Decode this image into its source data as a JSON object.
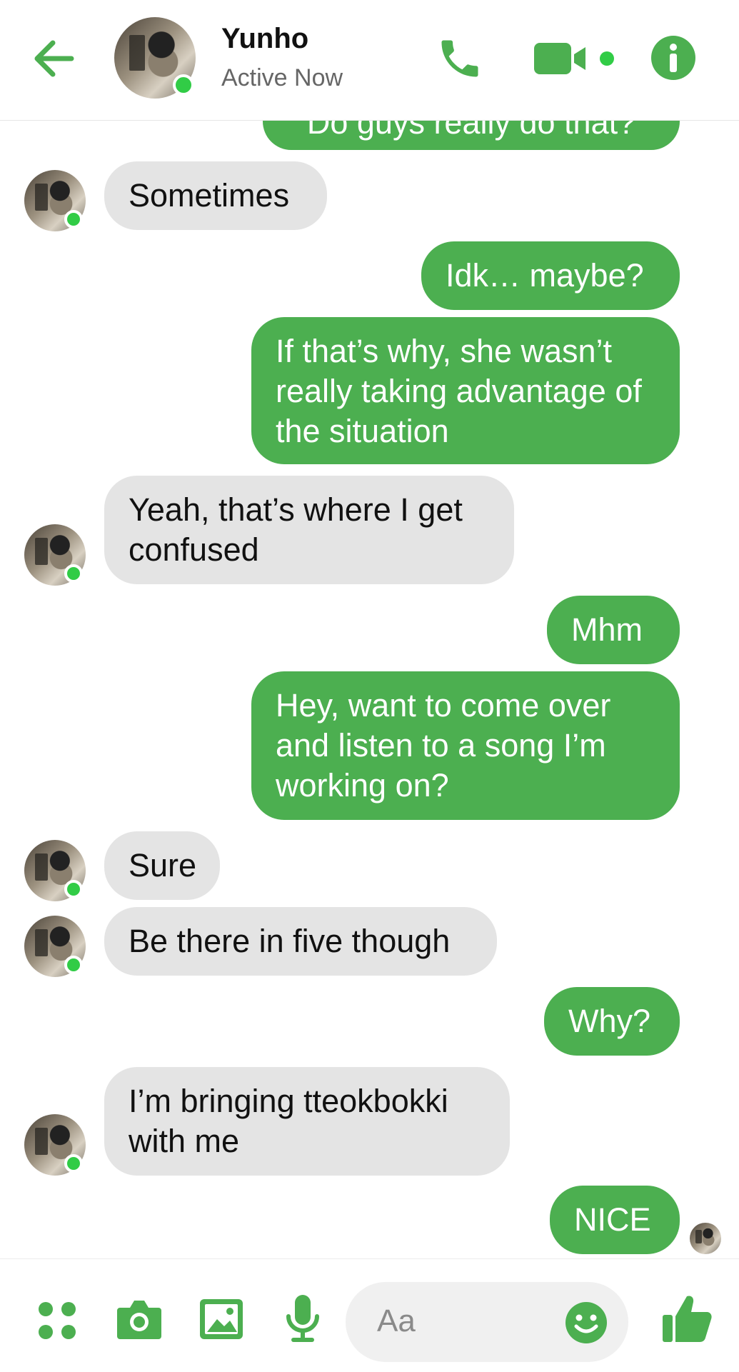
{
  "header": {
    "contact_name": "Yunho",
    "status": "Active Now",
    "icons": [
      "back-arrow-icon",
      "phone-icon",
      "video-camera-icon",
      "info-icon"
    ]
  },
  "colors": {
    "accent": "#4caf50",
    "incoming_bubble": "#e4e4e4",
    "online": "#31cc46"
  },
  "messages": [
    {
      "side": "out",
      "text": "Do guys really do that?"
    },
    {
      "side": "in",
      "text": "Sometimes"
    },
    {
      "side": "out",
      "text": "Idk… maybe?"
    },
    {
      "side": "out",
      "text": "If that’s why, she wasn’t really taking advantage of the situation"
    },
    {
      "side": "in",
      "text": "Yeah, that’s where I get confused"
    },
    {
      "side": "out",
      "text": "Mhm"
    },
    {
      "side": "out",
      "text": "Hey, want to come over and listen to a song I’m working on?"
    },
    {
      "side": "in",
      "text": "Sure"
    },
    {
      "side": "in",
      "text": "Be there in five though"
    },
    {
      "side": "out",
      "text": "Why?"
    },
    {
      "side": "in",
      "text": "I’m bringing tteokbokki with me"
    },
    {
      "side": "out",
      "text": "NICE"
    }
  ],
  "composer": {
    "placeholder": "Aa",
    "icons": [
      "apps-grid-icon",
      "camera-icon",
      "image-icon",
      "microphone-icon",
      "emoji-icon",
      "thumbs-up-icon"
    ]
  }
}
